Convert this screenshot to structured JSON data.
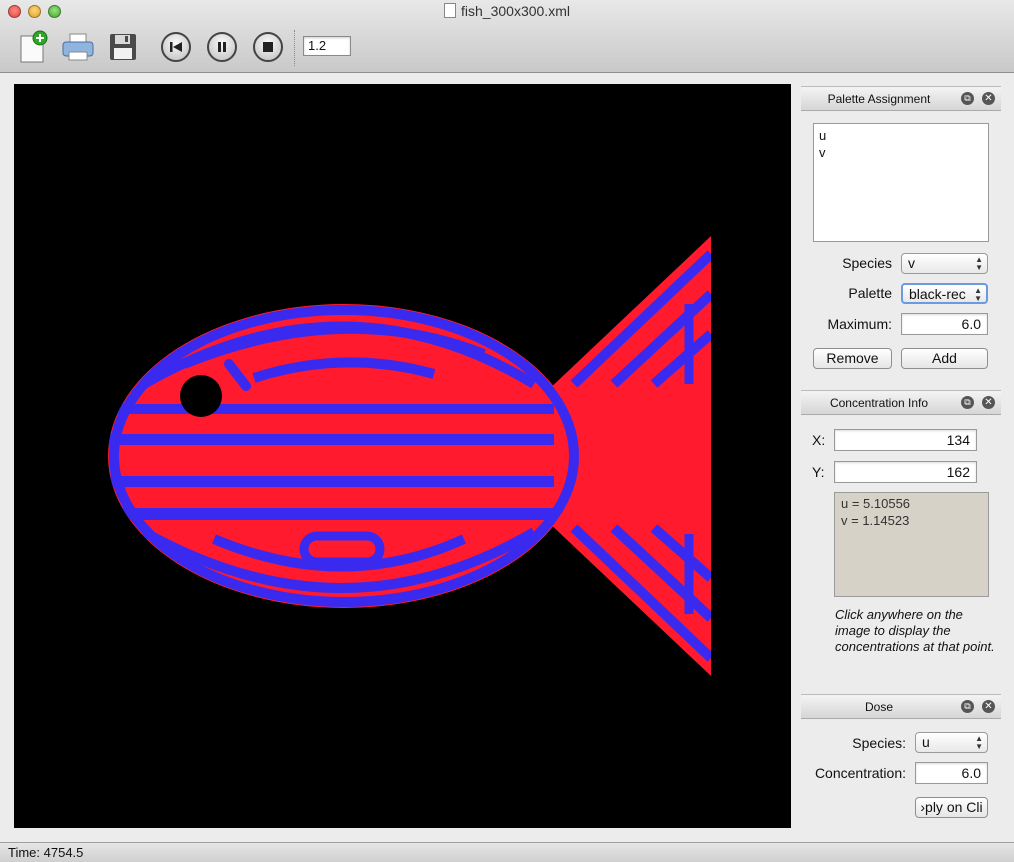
{
  "window": {
    "title": "fish_300x300.xml"
  },
  "toolbar": {
    "speed_value": "1.2",
    "icons": [
      "new-document-icon",
      "print-icon",
      "save-icon",
      "rewind-icon",
      "pause-icon",
      "stop-icon"
    ]
  },
  "palette_panel": {
    "title": "Palette Assignment",
    "list_items": [
      "u",
      "v"
    ],
    "species_label": "Species",
    "species_value": "v",
    "palette_label": "Palette",
    "palette_value": "black-rec",
    "maximum_label": "Maximum:",
    "maximum_value": "6.0",
    "remove_label": "Remove",
    "add_label": "Add"
  },
  "concentration_panel": {
    "title": "Concentration Info",
    "x_label": "X:",
    "x_value": "134",
    "y_label": "Y:",
    "y_value": "162",
    "readout_lines": [
      "u = 5.10556",
      "v = 1.14523"
    ],
    "hint": "Click anywhere on the image to display the concentrations at that point."
  },
  "dose_panel": {
    "title": "Dose",
    "species_label": "Species:",
    "species_value": "u",
    "concentration_label": "Concentration:",
    "concentration_value": "6.0",
    "apply_label": "›ply on Cli"
  },
  "status": {
    "text": "Time: 4754.5"
  },
  "colors": {
    "pattern_red": "#ff1a2e",
    "pattern_blue": "#3a2af0",
    "background": "#000000"
  }
}
